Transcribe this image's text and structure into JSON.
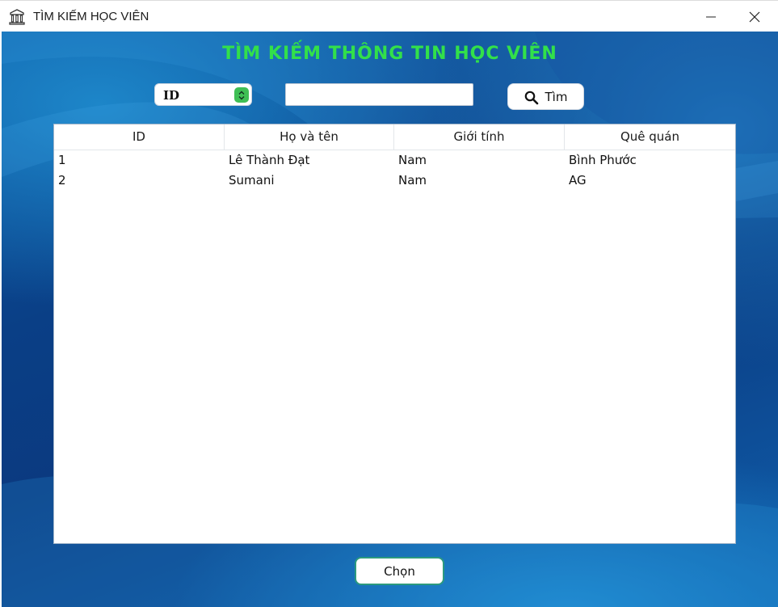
{
  "window": {
    "title": "TÌM KIẾM HỌC VIÊN",
    "icon": "book-building-icon",
    "controls": {
      "minimize_icon": "minimize-icon",
      "close_icon": "close-icon"
    }
  },
  "main": {
    "heading": "TÌM KIẾM THÔNG TIN HỌC VIÊN",
    "search": {
      "field_selected": "ID",
      "input_value": "",
      "button_label": "Tìm",
      "button_icon": "search-icon"
    },
    "table": {
      "columns": [
        "ID",
        "Họ và tên",
        "Giới tính",
        "Quê quán"
      ],
      "rows": [
        [
          "1",
          "Lê Thành Đạt",
          "Nam",
          "Bình Phước"
        ],
        [
          "2",
          "Sumani",
          "Nam",
          "AG"
        ]
      ]
    },
    "choose_button_label": "Chọn"
  },
  "colors": {
    "heading": "#32e04a",
    "background": "#0b3f86",
    "select_arrow": "#3fbf55",
    "choose_border": "#2b9a7e"
  }
}
